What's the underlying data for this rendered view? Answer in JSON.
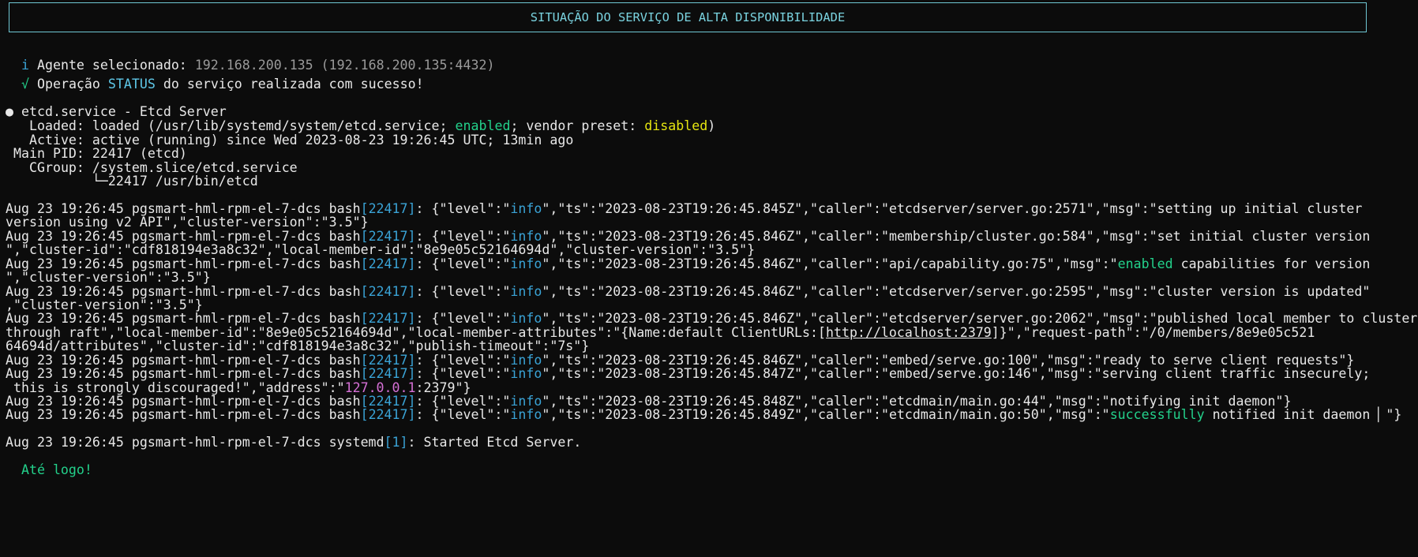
{
  "title": "SITUAÇÃO DO SERVIÇO DE ALTA DISPONIBILIDADE",
  "agent": {
    "icon": "i",
    "label": "Agente selecionado:",
    "value": "192.168.200.135 (192.168.200.135:4432)"
  },
  "operation": {
    "icon": "√",
    "before": "Operação",
    "keyword": "STATUS",
    "after": "do serviço realizada com sucesso!"
  },
  "service": {
    "bullet": "●",
    "name": "etcd.service - Etcd Server",
    "loaded_label": "Loaded:",
    "loaded_pre": "loaded (/usr/lib/systemd/system/etcd.service;",
    "loaded_enabled": "enabled",
    "loaded_mid": "; vendor preset:",
    "loaded_disabled": "disabled",
    "loaded_post": ")",
    "active_label": "Active:",
    "active_value": "active (running) since Wed 2023-08-23 19:26:45 UTC; 13min ago",
    "pid_label": "Main PID:",
    "pid_value": "22417 (etcd)",
    "cgroup_label": "CGroup:",
    "cgroup_value": "/system.slice/etcd.service",
    "cgroup_child": "└─22417 /usr/bin/etcd"
  },
  "log": {
    "prefix": "Aug 23 19:26:45 pgsmart-hml-rpm-el-7-dcs bash",
    "pid": "[22417]",
    "open": ": {\"level\":\"",
    "level": "info",
    "l1_rest": "\",\"ts\":\"2023-08-23T19:26:45.845Z\",\"caller\":\"etcdserver/server.go:2571\",\"msg\":\"setting up initial cluster",
    "l1_cont": "version using v2 API\",\"cluster-version\":\"3.5\"}",
    "l2_rest": "\",\"ts\":\"2023-08-23T19:26:45.846Z\",\"caller\":\"membership/cluster.go:584\",\"msg\":\"set initial cluster version",
    "l2_cont": "\",\"cluster-id\":\"cdf818194e3a8c32\",\"local-member-id\":\"8e9e05c52164694d\",\"cluster-version\":\"3.5\"}",
    "l3_rest_a": "\",\"ts\":\"2023-08-23T19:26:45.846Z\",\"caller\":\"api/capability.go:75\",\"msg\":\"",
    "l3_enabled": "enabled",
    "l3_rest_b": " capabilities for version",
    "l3_cont": "\",\"cluster-version\":\"3.5\"}",
    "l4_rest": "\",\"ts\":\"2023-08-23T19:26:45.846Z\",\"caller\":\"etcdserver/server.go:2595\",\"msg\":\"cluster version is updated\"",
    "l4_cont": ",\"cluster-version\":\"3.5\"}",
    "l5_rest": "\",\"ts\":\"2023-08-23T19:26:45.846Z\",\"caller\":\"etcdserver/server.go:2062\",\"msg\":\"published local member to cluster",
    "l5_cont_a": "through raft\",\"local-member-id\":\"8e9e05c52164694d\",\"local-member-attributes\":\"{Name:default ClientURLs:[",
    "l5_link": "http://localhost:2379",
    "l5_cont_b": "]}\",\"request-path\":\"/0/members/8e9e05c521",
    "l5_cont2": "64694d/attributes\",\"cluster-id\":\"cdf818194e3a8c32\",\"publish-timeout\":\"7s\"}",
    "l6_rest": "\",\"ts\":\"2023-08-23T19:26:45.846Z\",\"caller\":\"embed/serve.go:100\",\"msg\":\"ready to serve client requests\"}",
    "l7_rest": "\",\"ts\":\"2023-08-23T19:26:45.847Z\",\"caller\":\"embed/serve.go:146\",\"msg\":\"serving client traffic insecurely;",
    "l7_cont_a": " this is strongly discouraged!\",\"address\":\"",
    "l7_ip": "127.0.0.1",
    "l7_cont_b": ":2379\"}",
    "l8_rest": "\",\"ts\":\"2023-08-23T19:26:45.848Z\",\"caller\":\"etcdmain/main.go:44\",\"msg\":\"notifying init daemon\"}",
    "l9_rest_a": "\",\"ts\":\"2023-08-23T19:26:45.849Z\",\"caller\":\"etcdmain/main.go:50\",\"msg\":\"",
    "l9_success": "successfully",
    "l9_rest_b": " notified init daemon",
    "l9_cursor": "▏",
    "l9_end": "\"}",
    "systemd_prefix": "Aug 23 19:26:45 pgsmart-hml-rpm-el-7-dcs systemd",
    "systemd_pid": "[1]",
    "systemd_msg": ": Started Etcd Server."
  },
  "farewell": "Até logo!"
}
